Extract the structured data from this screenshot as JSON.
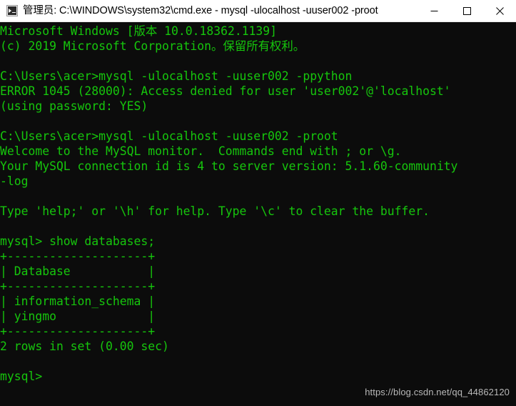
{
  "window": {
    "title": "管理员: C:\\WINDOWS\\system32\\cmd.exe - mysql  -ulocalhost -uuser002 -proot",
    "icon": "cmd-console-icon",
    "controls": {
      "minimize_label": "–",
      "maximize_label": "□",
      "close_label": "✕"
    },
    "colors": {
      "titlebar_background": "#ffffff",
      "titlebar_text": "#000000",
      "console_background": "#0c0c0c",
      "console_text": "#16c60c",
      "watermark_text": "#b9b9b9"
    }
  },
  "console": {
    "lines": [
      "Microsoft Windows [版本 10.0.18362.1139]",
      "(c) 2019 Microsoft Corporation。保留所有权利。",
      "",
      "C:\\Users\\acer>mysql -ulocalhost -uuser002 -ppython",
      "ERROR 1045 (28000): Access denied for user 'user002'@'localhost'",
      "(using password: YES)",
      "",
      "C:\\Users\\acer>mysql -ulocalhost -uuser002 -proot",
      "Welcome to the MySQL monitor.  Commands end with ; or \\g.",
      "Your MySQL connection id is 4 to server version: 5.1.60-community",
      "-log",
      "",
      "Type 'help;' or '\\h' for help. Type '\\c' to clear the buffer.",
      "",
      "mysql> show databases;",
      "+--------------------+",
      "| Database           |",
      "+--------------------+",
      "| information_schema |",
      "| yingmo             |",
      "+--------------------+",
      "2 rows in set (0.00 sec)",
      "",
      "mysql>"
    ],
    "text": "Microsoft Windows [版本 10.0.18362.1139]\n(c) 2019 Microsoft Corporation。保留所有权利。\n\nC:\\Users\\acer>mysql -ulocalhost -uuser002 -ppython\nERROR 1045 (28000): Access denied for user 'user002'@'localhost'\n(using password: YES)\n\nC:\\Users\\acer>mysql -ulocalhost -uuser002 -proot\nWelcome to the MySQL monitor.  Commands end with ; or \\g.\nYour MySQL connection id is 4 to server version: 5.1.60-community\n-log\n\nType 'help;' or '\\h' for help. Type '\\c' to clear the buffer.\n\nmysql> show databases;\n+--------------------+\n| Database           |\n+--------------------+\n| information_schema |\n| yingmo             |\n+--------------------+\n2 rows in set (0.00 sec)\n\nmysql>",
    "prompt": "mysql>",
    "commands": [
      "mysql -ulocalhost -uuser002 -ppython",
      "mysql -ulocalhost -uuser002 -proot",
      "show databases;"
    ],
    "result_table": {
      "columns": [
        "Database"
      ],
      "rows": [
        [
          "information_schema"
        ],
        [
          "yingmo"
        ]
      ],
      "row_count_text": "2 rows in set (0.00 sec)"
    },
    "error": {
      "code": "ERROR 1045 (28000)",
      "message": "Access denied for user 'user002'@'localhost' (using password: YES)"
    },
    "server_version": "5.1.60-community-log",
    "connection_id": "4"
  },
  "watermark": {
    "url": "https://blog.csdn.net/qq_44862120"
  }
}
